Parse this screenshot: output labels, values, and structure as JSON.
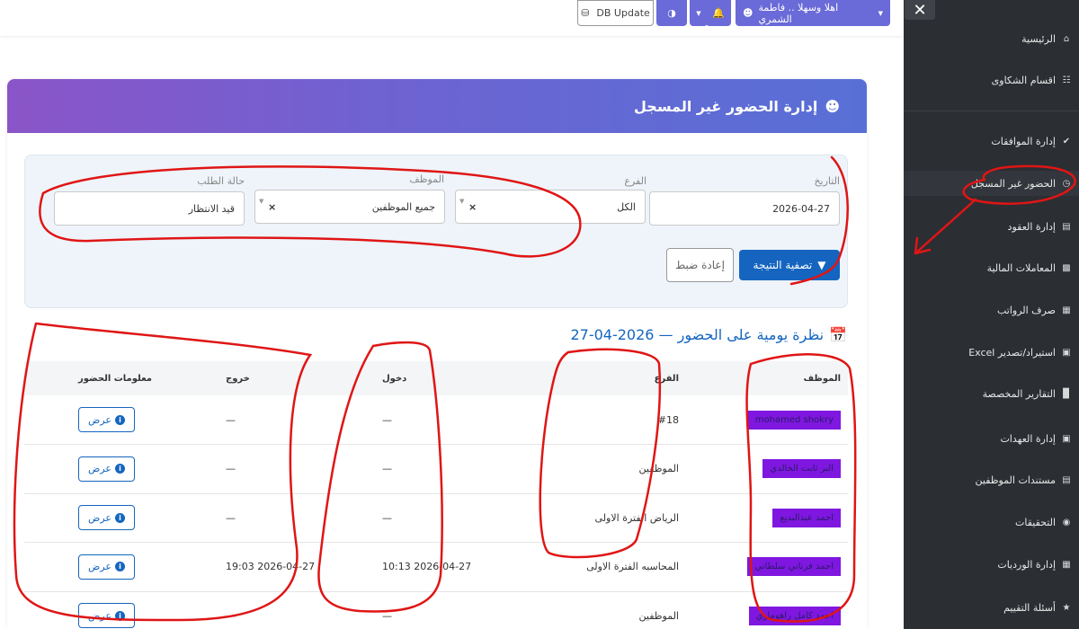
{
  "topbar": {
    "user_greeting": "اهلا وسهلا .. فاطمة الشمري",
    "db_update": "DB Update",
    "colors": {
      "primary_btn": "#6a6ad8"
    }
  },
  "sidebar": {
    "items": [
      {
        "label": "الرئيسية",
        "icon": "home-icon"
      },
      {
        "label": "اقسام الشكاوى",
        "icon": "sitemap-icon"
      },
      {
        "label": "إدارة الموافقات",
        "icon": "check-circle-icon"
      },
      {
        "label": "الحضور غير المسجل",
        "icon": "clock-icon"
      },
      {
        "label": "إدارة العقود",
        "icon": "document-icon"
      },
      {
        "label": "المعاملات المالية",
        "icon": "money-icon"
      },
      {
        "label": "صرف الرواتب",
        "icon": "wallet-icon"
      },
      {
        "label": "استيراد/تصدير Excel",
        "icon": "excel-icon"
      },
      {
        "label": "التقارير المخصصة",
        "icon": "chart-icon"
      },
      {
        "label": "إدارة العهدات",
        "icon": "box-icon"
      },
      {
        "label": "مستندات الموظفين",
        "icon": "file-icon"
      },
      {
        "label": "التحقيقات",
        "icon": "comments-icon"
      },
      {
        "label": "إدارة الورديات",
        "icon": "calendar-icon"
      },
      {
        "label": "أسئلة التقييم",
        "icon": "star-icon"
      }
    ]
  },
  "page": {
    "title": "إدارة الحضور غير المسجل",
    "filters": {
      "date_label": "التاريخ",
      "date_value": "2026-04-27",
      "branch_label": "الفرع",
      "branch_value": "الكل",
      "employee_label": "الموظف",
      "employee_value": "جميع الموظفين",
      "status_label": "حالة الطلب",
      "status_value": "قيد الانتظار",
      "filter_button": "تصفية النتيجة",
      "reset_button": "إعادة ضبط"
    },
    "overview_title": "نظرة يومية على الحضور — 2026-04-27",
    "table": {
      "headers": {
        "employee": "الموظف",
        "branch": "الفرع",
        "check_in": "دخول",
        "check_out": "خروج",
        "info": "معلومات الحضور"
      },
      "view_label": "عرض",
      "rows": [
        {
          "employee": "mohamed shokry",
          "branch": "#18",
          "check_in": "—",
          "check_out": "—"
        },
        {
          "employee": "البر ثابت الخالدي",
          "branch": "الموظفين",
          "check_in": "—",
          "check_out": "—"
        },
        {
          "employee": "احمد عبدالبديع",
          "branch": "الرياض الفترة الاولى",
          "check_in": "—",
          "check_out": "—"
        },
        {
          "employee": "احمد فرناني سلطاني",
          "branch": "المحاسبه الفترة الاولى",
          "check_in": "2026-04-27 10:13",
          "check_out": "2026-04-27 19:03"
        },
        {
          "employee": "احمد كامل راهوماوي",
          "branch": "الموظفين",
          "check_in": "—",
          "check_out": "—"
        }
      ]
    }
  }
}
